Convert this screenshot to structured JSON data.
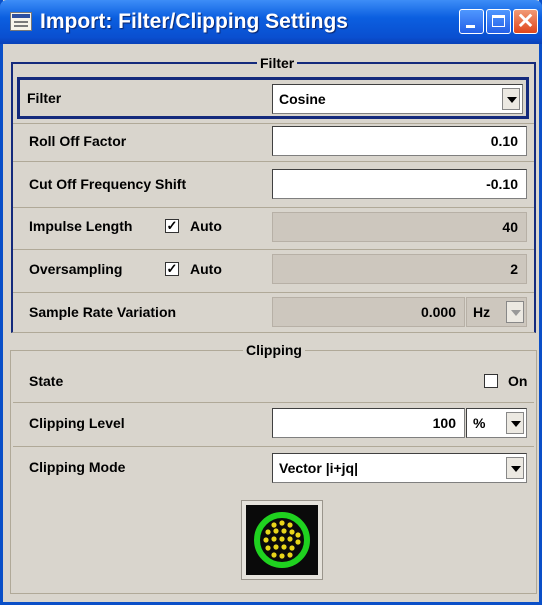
{
  "window": {
    "title": "Import: Filter/Clipping Settings",
    "icon": "dialog-window-icon"
  },
  "filter_section": {
    "title": "Filter",
    "filter": {
      "label": "Filter",
      "value": "Cosine"
    },
    "roll_off": {
      "label": "Roll Off Factor",
      "value": "0.10"
    },
    "cut_off": {
      "label": "Cut Off Frequency Shift",
      "value": "-0.10"
    },
    "impulse": {
      "label": "Impulse Length",
      "auto_label": "Auto",
      "auto_checked": true,
      "value": "40"
    },
    "oversampling": {
      "label": "Oversampling",
      "auto_label": "Auto",
      "auto_checked": true,
      "value": "2"
    },
    "sample_rate": {
      "label": "Sample Rate Variation",
      "value": "0.000",
      "unit": "Hz"
    }
  },
  "clipping_section": {
    "title": "Clipping",
    "state": {
      "label": "State",
      "on_label": "On",
      "checked": false
    },
    "level": {
      "label": "Clipping Level",
      "value": "100",
      "unit": "%"
    },
    "mode": {
      "label": "Clipping Mode",
      "value": "Vector |i+jq|"
    }
  },
  "colors": {
    "title_bar": "#0a4fd0",
    "panel": "#d9d5cd",
    "focus_border": "#142a7c",
    "clip_graphic_ring": "#1fd21f",
    "clip_graphic_dots": "#e8d51a"
  }
}
